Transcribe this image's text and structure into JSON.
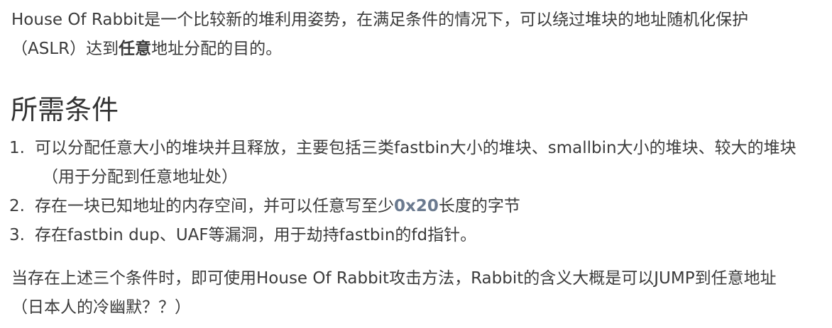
{
  "intro": {
    "before": "House Of Rabbit是一个比较新的堆利用姿势，在满足条件的情况下，可以绕过堆块的地址随机化保护",
    "line2_before": "（ASLR）达到",
    "bold": "任意",
    "after": "地址分配的目的。"
  },
  "heading": "所需条件",
  "requirements": [
    {
      "num": "1.",
      "line1": "可以分配任意大小的堆块并且释放，主要包括三类fastbin大小的堆块、smallbin大小的堆块、较大的堆块",
      "line2": "（用于分配到任意地址处）"
    },
    {
      "num": "2.",
      "before": "存在一块已知地址的内存空间，并可以任意写至少",
      "code": "0x20",
      "after": "长度的字节"
    },
    {
      "num": "3.",
      "text": "存在fastbin dup、UAF等漏洞，用于劫持fastbin的fd指针。"
    }
  ],
  "outro": {
    "line1": "当存在上述三个条件时，即可使用House Of Rabbit攻击方法，Rabbit的含义大概是可以JUMP到任意地址",
    "line2": "（日本人的冷幽默？？）"
  }
}
